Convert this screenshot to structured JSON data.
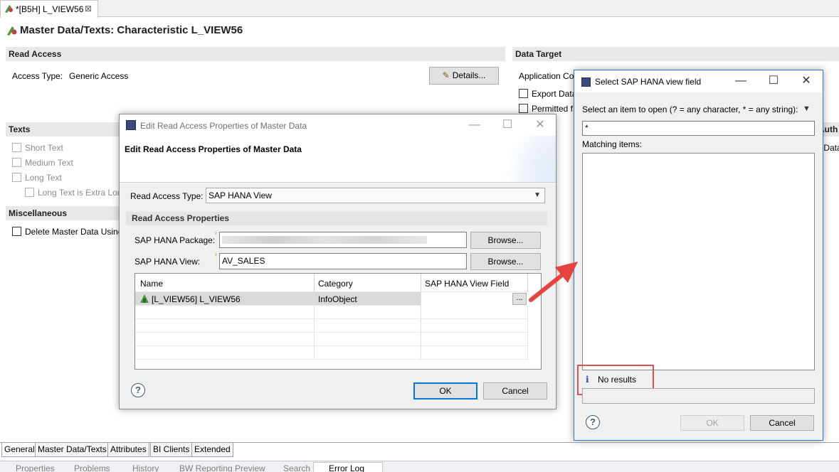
{
  "editor_tab": {
    "title": "*[B5H] L_VIEW56",
    "close": "⊠"
  },
  "page_title": "Master Data/Texts: Characteristic L_VIEW56",
  "read_access": {
    "header": "Read Access",
    "access_type_label": "Access Type:",
    "access_type_value": "Generic Access",
    "details_button": "Details..."
  },
  "data_target": {
    "header": "Data Target",
    "application_label": "Application Co",
    "export_label": "Export Data",
    "permitted_label": "Permitted f",
    "auth_label": "Auth",
    "r_data_label": "r Data"
  },
  "texts": {
    "header": "Texts",
    "short_text": "Short Text",
    "medium_text": "Medium Text",
    "long_text": "Long Text",
    "long_text_extra": "Long Text is Extra Long"
  },
  "misc": {
    "header": "Miscellaneous",
    "delete_label": "Delete Master Data Using"
  },
  "edit_dialog": {
    "window_title": "Edit Read Access Properties of Master Data",
    "banner_title": "Edit Read Access Properties of Master Data",
    "read_access_type_label": "Read Access Type:",
    "read_access_type_value": "SAP HANA View",
    "properties_header": "Read Access Properties",
    "package_label": "SAP HANA Package:",
    "package_value": "",
    "view_label": "SAP HANA View:",
    "view_value": "AV_SALES",
    "browse_label": "Browse...",
    "table": {
      "col_name": "Name",
      "col_category": "Category",
      "col_field": "SAP HANA View Field",
      "row_name": "[L_VIEW56] L_VIEW56",
      "row_category": "InfoObject",
      "row_button": "..."
    },
    "ok": "OK",
    "cancel": "Cancel",
    "help": "?"
  },
  "select_dialog": {
    "window_title": "Select SAP HANA view field",
    "prompt": "Select an item to open (? = any character, * = any string):",
    "filter_value": "*",
    "matching_label": "Matching items:",
    "status_icon": "i",
    "status_text": "No results",
    "ok": "OK",
    "cancel": "Cancel",
    "help": "?"
  },
  "bottom_tabs": [
    "General",
    "Master Data/Texts",
    "Attributes",
    "BI Clients",
    "Extended"
  ],
  "view_tabs": [
    "Properties",
    "Problems",
    "History",
    "BW Reporting Preview",
    "Search",
    "Error Log"
  ],
  "colors": {
    "arrow": "#e8423f",
    "highlight_box": "#e05050",
    "focus_blue": "#0078d7"
  }
}
